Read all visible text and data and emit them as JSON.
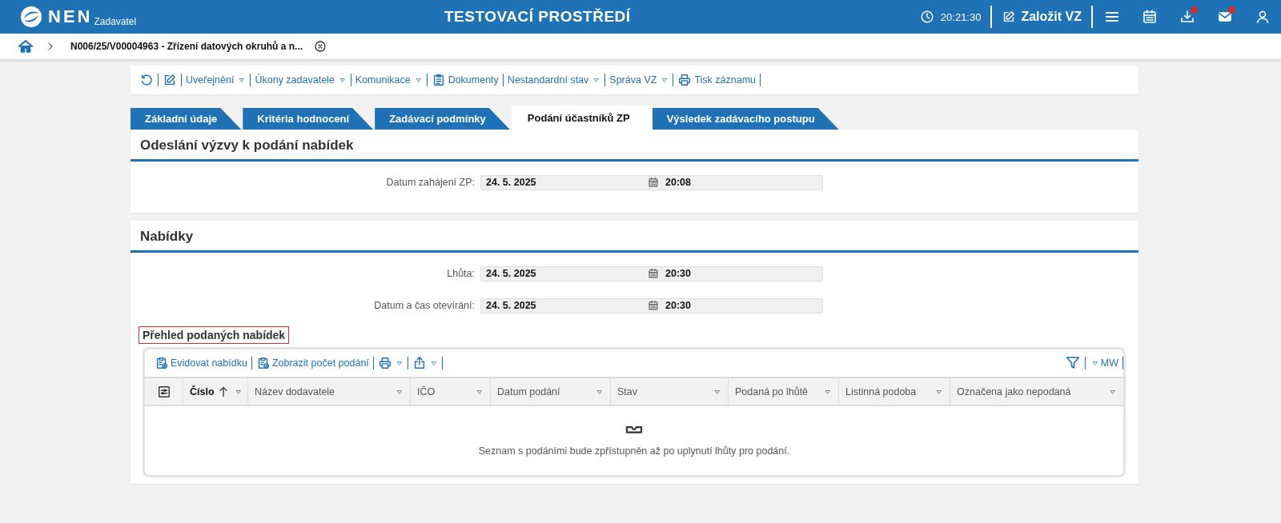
{
  "header": {
    "logo": "NEN",
    "logo_subtitle": "Zadavatel",
    "environment": "TESTOVACÍ PROSTŘEDÍ",
    "clock": "20:21:30",
    "create_button": "Založit VZ",
    "icons": [
      {
        "kind": "menu",
        "badge": false
      },
      {
        "kind": "calendar",
        "badge": false
      },
      {
        "kind": "download",
        "badge": true
      },
      {
        "kind": "mail",
        "badge": true
      },
      {
        "kind": "user",
        "badge": false
      }
    ]
  },
  "breadcrumb": {
    "title": "N006/25/V00004963 - Zřízení datových okruhů a n..."
  },
  "toolbar": [
    {
      "kind": "refresh"
    },
    {
      "kind": "edit"
    },
    {
      "kind": "menu",
      "label": "Uveřejnění"
    },
    {
      "kind": "menu",
      "label": "Úkony zadavatele"
    },
    {
      "kind": "menu",
      "label": "Komunikace"
    },
    {
      "kind": "documents",
      "label": "Dokumenty"
    },
    {
      "kind": "menu",
      "label": "Nestandardní stav"
    },
    {
      "kind": "menu",
      "label": "Správa VZ"
    },
    {
      "kind": "print",
      "label": "Tisk záznamu"
    }
  ],
  "tabs": [
    {
      "label": "Základní údaje",
      "selected": false
    },
    {
      "label": "Kritéria hodnocení",
      "selected": false
    },
    {
      "label": "Zadávací podmínky",
      "selected": false
    },
    {
      "label": "Podání účastníků ZP",
      "selected": true
    },
    {
      "label": "Výsledek zadávacího postupu",
      "selected": false
    }
  ],
  "sections": [
    {
      "title": "Odeslání výzvy k podání nabídek",
      "fields": [
        {
          "label": "Datum zahájení ZP:",
          "date": "24. 5. 2025",
          "time": "20:08"
        }
      ]
    },
    {
      "title": "Nabídky",
      "fields": [
        {
          "label": "Lhůta:",
          "date": "24. 5. 2025",
          "time": "20:30"
        },
        {
          "label": "Datum a čas otevírání:",
          "date": "24. 5. 2025",
          "time": "20:30"
        }
      ],
      "subheading": {
        "text": "Přehled podaných nabídek",
        "highlighted": true
      },
      "table": {
        "toolbar": [
          {
            "kind": "register",
            "label": "Evidovat nabídku"
          },
          {
            "kind": "count",
            "label": "Zobrazit počet podání"
          },
          {
            "kind": "print"
          },
          {
            "kind": "export"
          }
        ],
        "right_toolbar": [
          {
            "kind": "filter"
          },
          {
            "kind": "view",
            "label": "MW"
          }
        ],
        "columns": [
          {
            "label": "Číslo",
            "sorted": true
          },
          {
            "label": "Název dodavatele",
            "sorted": false
          },
          {
            "label": "IČO",
            "sorted": false
          },
          {
            "label": "Datum podání",
            "sorted": false
          },
          {
            "label": "Stav",
            "sorted": false
          },
          {
            "label": "Podaná po lhůtě",
            "sorted": false
          },
          {
            "label": "Listinná podoba",
            "sorted": false
          },
          {
            "label": "Označena jako nepodaná",
            "sorted": false
          }
        ],
        "empty_message": "Seznam s podáními bude zpřístupněn až po uplynutí lhůty pro podání."
      }
    }
  ]
}
